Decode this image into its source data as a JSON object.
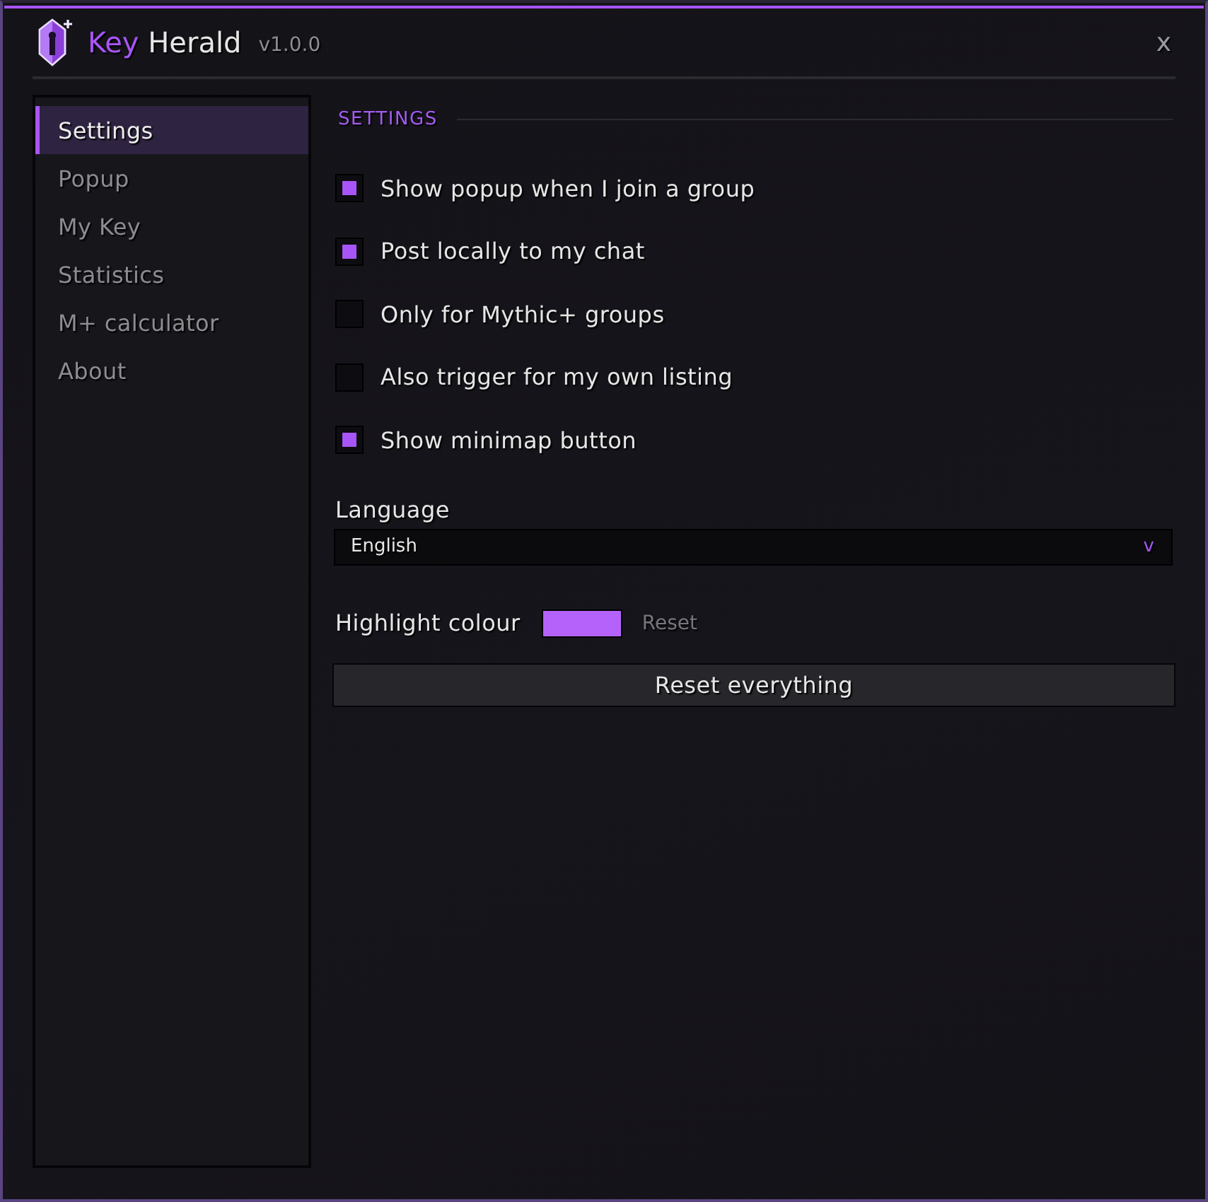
{
  "window": {
    "title_accent": "Key",
    "title": "Herald",
    "version": "v1.0.0",
    "close": "x"
  },
  "sidebar": {
    "items": [
      {
        "label": "Settings",
        "selected": true
      },
      {
        "label": "Popup",
        "selected": false
      },
      {
        "label": "My Key",
        "selected": false
      },
      {
        "label": "Statistics",
        "selected": false
      },
      {
        "label": "M+ calculator",
        "selected": false
      },
      {
        "label": "About",
        "selected": false
      }
    ]
  },
  "section": {
    "heading": "SETTINGS"
  },
  "options": [
    {
      "label": "Show popup when I join a group",
      "checked": true
    },
    {
      "label": "Post locally to my chat",
      "checked": true
    },
    {
      "label": "Only for Mythic+ groups",
      "checked": false
    },
    {
      "label": "Also trigger for my own listing",
      "checked": false
    },
    {
      "label": "Show minimap button",
      "checked": true
    }
  ],
  "language": {
    "label": "Language",
    "value": "English",
    "caret": "v"
  },
  "highlight": {
    "label": "Highlight colour",
    "color": "#b462fa",
    "reset": "Reset"
  },
  "reset_button": "Reset everything"
}
